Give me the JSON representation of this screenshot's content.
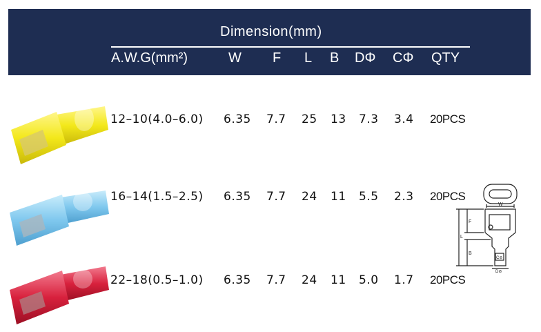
{
  "header": {
    "title": "Dimension(mm)",
    "columns": [
      "A.W.G(mm²)",
      "W",
      "F",
      "L",
      "B",
      "DΦ",
      "CΦ",
      "QTY"
    ]
  },
  "rows": [
    {
      "color": "yellow",
      "awg": "12–10(4.0–6.0)",
      "w": "6.35",
      "f": "7.7",
      "l": "25",
      "b": "13",
      "d": "7.3",
      "c": "3.4",
      "qty": "20PCS"
    },
    {
      "color": "blue",
      "awg": "16–14(1.5–2.5)",
      "w": "6.35",
      "f": "7.7",
      "l": "24",
      "b": "11",
      "d": "5.5",
      "c": "2.3",
      "qty": "20PCS"
    },
    {
      "color": "red",
      "awg": "22–18(0.5–1.0)",
      "w": "6.35",
      "f": "7.7",
      "l": "24",
      "b": "11",
      "d": "5.0",
      "c": "1.7",
      "qty": "20PCS"
    }
  ],
  "colors": {
    "header_bg": "#1e2d52",
    "yellow": "#f3e81a",
    "blue": "#7fc8ee",
    "red": "#d8213d"
  },
  "diagram": {
    "labels": {
      "w": "W",
      "f": "F",
      "l": "L",
      "b": "B",
      "c": "C⊘",
      "d": "D⊘"
    }
  }
}
